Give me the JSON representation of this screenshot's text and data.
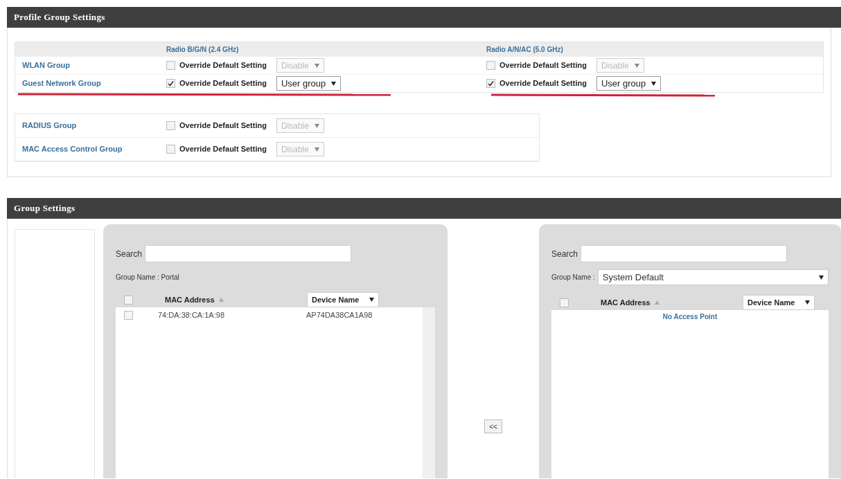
{
  "profile_group_settings": {
    "title": "Profile Group Settings",
    "columns": [
      "Radio B/G/N (2.4 GHz)",
      "Radio A/N/AC (5.0 GHz)"
    ],
    "rows": [
      {
        "label": "WLAN Group",
        "underlined": false,
        "settings": [
          {
            "label": "Override Default Setting",
            "checked": false,
            "value": "Disable"
          },
          {
            "label": "Override Default Setting",
            "checked": false,
            "value": "Disable"
          }
        ]
      },
      {
        "label": "Guest Network Group",
        "underlined": true,
        "settings": [
          {
            "label": "Override Default Setting",
            "checked": true,
            "value": "User group"
          },
          {
            "label": "Override Default Setting",
            "checked": true,
            "value": "User group"
          }
        ]
      }
    ],
    "other_rows": [
      {
        "label": "RADIUS Group",
        "setting": {
          "label": "Override Default Setting",
          "checked": false,
          "value": "Disable"
        }
      },
      {
        "label": "MAC Access Control Group",
        "setting": {
          "label": "Override Default Setting",
          "checked": false,
          "value": "Disable"
        }
      }
    ]
  },
  "group_settings": {
    "title": "Group Settings",
    "left_panel": {
      "search_label": "Search",
      "group_name": "Group Name : Portal",
      "columns": [
        "MAC Address",
        "Device Name"
      ],
      "all_checked": false,
      "rows": [
        {
          "mac": "74:DA:38:CA:1A:98",
          "device": "AP74DA38CA1A98",
          "checked": false
        }
      ]
    },
    "move_button": "<<",
    "right_panel": {
      "search_label": "Search",
      "group_name_label": "Group Name :",
      "group_name_value": "System Default",
      "columns": [
        "MAC Address",
        "Device Name"
      ],
      "all_checked": false,
      "empty_message": "No Access Point"
    }
  }
}
